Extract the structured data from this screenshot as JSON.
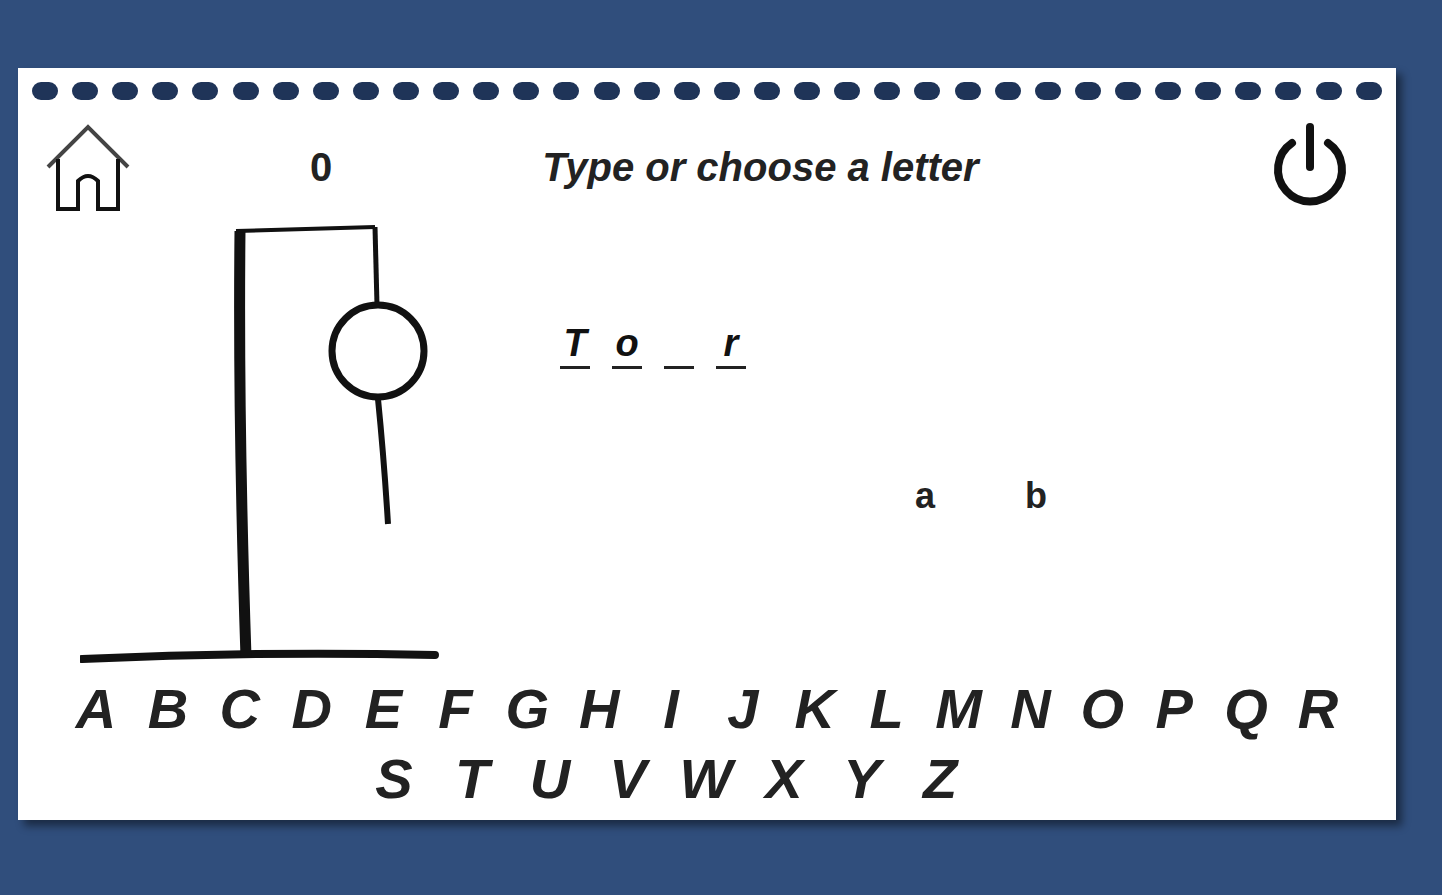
{
  "header": {
    "score": "0",
    "prompt": "Type or choose a letter"
  },
  "figure": {
    "head": true,
    "body": true,
    "left_arm": false,
    "right_arm": false,
    "left_leg": false,
    "right_leg": false
  },
  "word": [
    {
      "letter": "T",
      "revealed": true
    },
    {
      "letter": "o",
      "revealed": true
    },
    {
      "letter": "",
      "revealed": false
    },
    {
      "letter": "r",
      "revealed": true
    }
  ],
  "wrong_guesses": [
    "a",
    "b"
  ],
  "keyboard": [
    [
      "A",
      "B",
      "C",
      "D",
      "E",
      "F",
      "G",
      "H",
      "I",
      "J",
      "K",
      "L",
      "M",
      "N",
      "O",
      "P",
      "Q",
      "R"
    ],
    [
      "S",
      "T",
      "U",
      "V",
      "W",
      "X",
      "Y",
      "Z"
    ]
  ]
}
